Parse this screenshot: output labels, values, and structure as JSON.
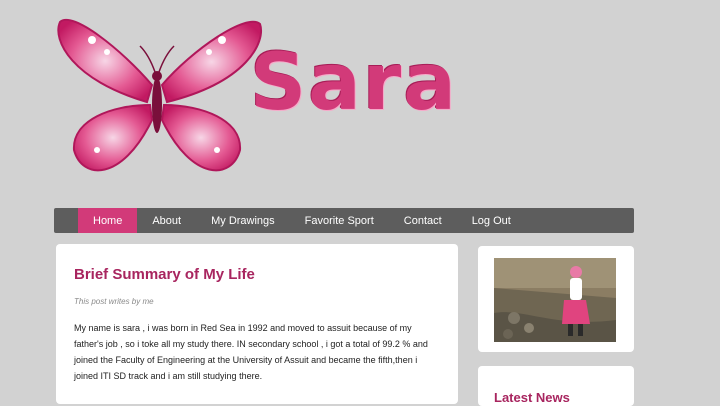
{
  "header": {
    "brand_name": "Sara",
    "logo_icon": "butterfly-icon",
    "accent_color": "#d23a79"
  },
  "nav": {
    "items": [
      {
        "label": "Home",
        "active": true
      },
      {
        "label": "About",
        "active": false
      },
      {
        "label": "My Drawings",
        "active": false
      },
      {
        "label": "Favorite Sport",
        "active": false
      },
      {
        "label": "Contact",
        "active": false
      },
      {
        "label": "Log Out",
        "active": false
      }
    ]
  },
  "post": {
    "title": "Brief Summary of My Life",
    "meta": "This post writes by me",
    "body": "My name is sara , i was born in Red Sea in 1992 and moved to assuit because of my father's job , so i toke all my study there. IN secondary school , i got a total of 99.2 % and joined the Faculty of Engineering at the University of Assuit and became the fifth,then i joined ITI SD track and i am still studying there."
  },
  "sidebar": {
    "news_title": "Latest News"
  }
}
